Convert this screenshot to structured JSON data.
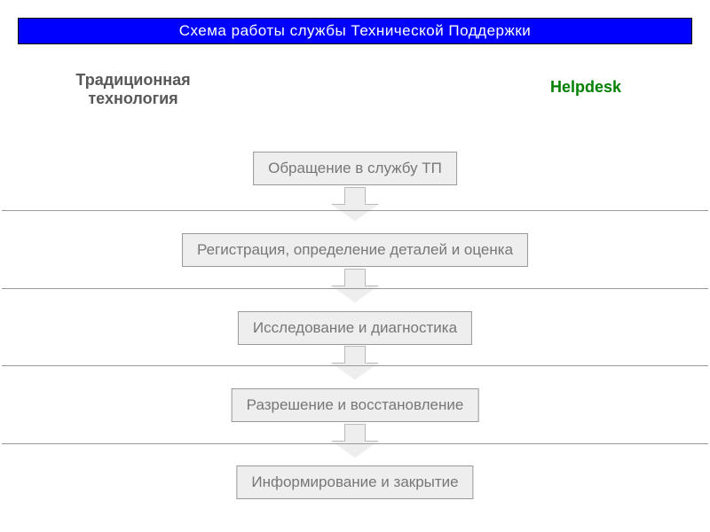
{
  "header": {
    "title": "Схема работы службы Технической Поддержки"
  },
  "columns": {
    "traditional_label": "Традиционная технология",
    "helpdesk_label": "Helpdesk"
  },
  "flow": {
    "steps": [
      {
        "label": "Обращение в службу ТП"
      },
      {
        "label": "Регистрация, определение деталей и оценка"
      },
      {
        "label": "Исследование и диагностика"
      },
      {
        "label": "Разрешение и восстановление"
      },
      {
        "label": "Информирование и закрытие"
      }
    ]
  }
}
